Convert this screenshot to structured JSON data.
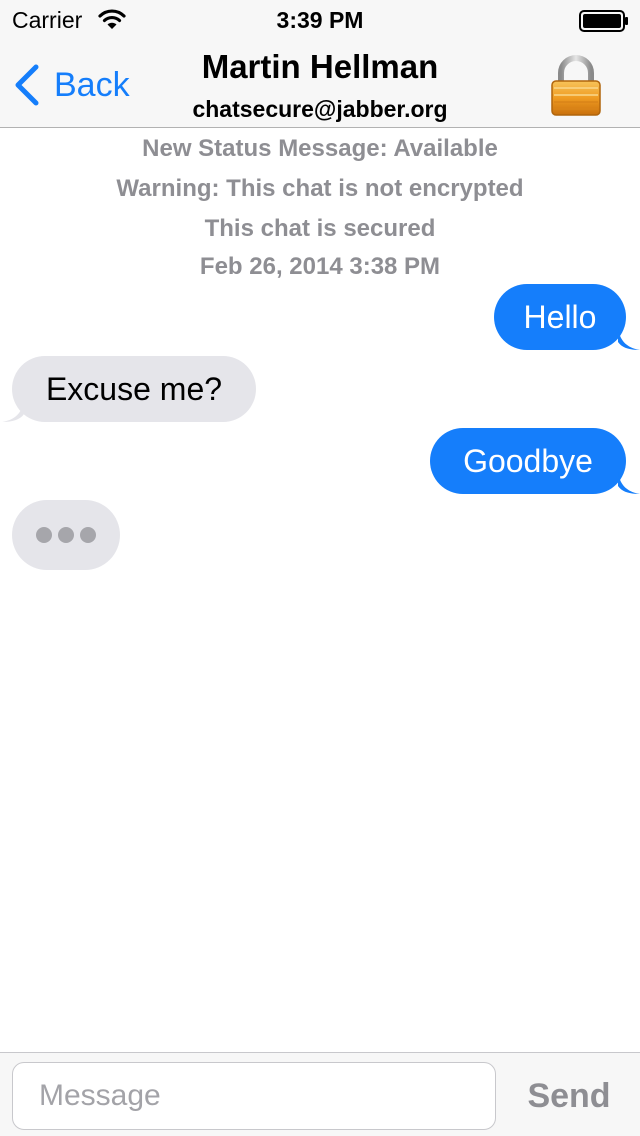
{
  "status_bar": {
    "carrier": "Carrier",
    "time": "3:39 PM"
  },
  "nav": {
    "back_label": "Back",
    "title": "Martin Hellman",
    "subtitle": "chatsecure@jabber.org"
  },
  "system_messages": [
    "New Status Message: Available",
    "Warning: This chat is not encrypted",
    "This chat is secured",
    "Feb 26, 2014 3:38 PM"
  ],
  "messages": [
    {
      "text": "Hello",
      "direction": "outgoing"
    },
    {
      "text": "Excuse me?",
      "direction": "incoming"
    },
    {
      "text": "Goodbye",
      "direction": "outgoing"
    }
  ],
  "typing_indicator": true,
  "input_bar": {
    "placeholder": "Message",
    "value": "",
    "send_label": "Send"
  },
  "colors": {
    "accent": "#157efb",
    "incoming_bubble": "#e5e5ea",
    "system_text": "#8e8e93",
    "lock_gold": "#f0a030"
  },
  "icons": {
    "wifi": "wifi-icon",
    "battery": "battery-icon",
    "back": "back-chevron-icon",
    "lock": "lock-icon"
  }
}
